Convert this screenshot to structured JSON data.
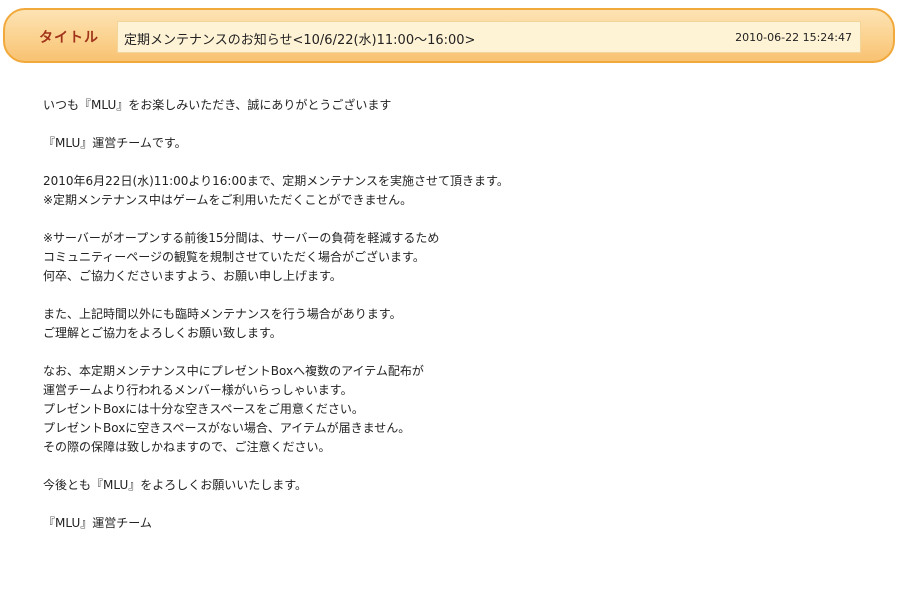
{
  "header": {
    "label": "タイトル",
    "title": "定期メンテナンスのお知らせ<10/6/22(水)11:00〜16:00>",
    "datetime": "2010-06-22 15:24:47"
  },
  "body": {
    "paragraphs": [
      [
        "いつも『MLU』をお楽しみいただき、誠にありがとうございます"
      ],
      [
        "『MLU』運営チームです。"
      ],
      [
        "2010年6月22日(水)11:00より16:00まで、定期メンテナンスを実施させて頂きます。",
        "※定期メンテナンス中はゲームをご利用いただくことができません。"
      ],
      [
        "※サーバーがオープンする前後15分間は、サーバーの負荷を軽減するため",
        "コミュニティーページの観覧を規制させていただく場合がございます。",
        "何卒、ご協力くださいますよう、お願い申し上げます。"
      ],
      [
        "また、上記時間以外にも臨時メンテナンスを行う場合があります。",
        "ご理解とご協力をよろしくお願い致します。"
      ],
      [
        "なお、本定期メンテナンス中にプレゼントBoxへ複数のアイテム配布が",
        "運営チームより行われるメンバー様がいらっしゃいます。",
        "プレゼントBoxには十分な空きスペースをご用意ください。",
        "プレゼントBoxに空きスペースがない場合、アイテムが届きません。",
        "その際の保障は致しかねますので、ご注意ください。"
      ],
      [
        "今後とも『MLU』をよろしくお願いいたします。"
      ],
      [
        "『MLU』運営チーム"
      ]
    ]
  }
}
